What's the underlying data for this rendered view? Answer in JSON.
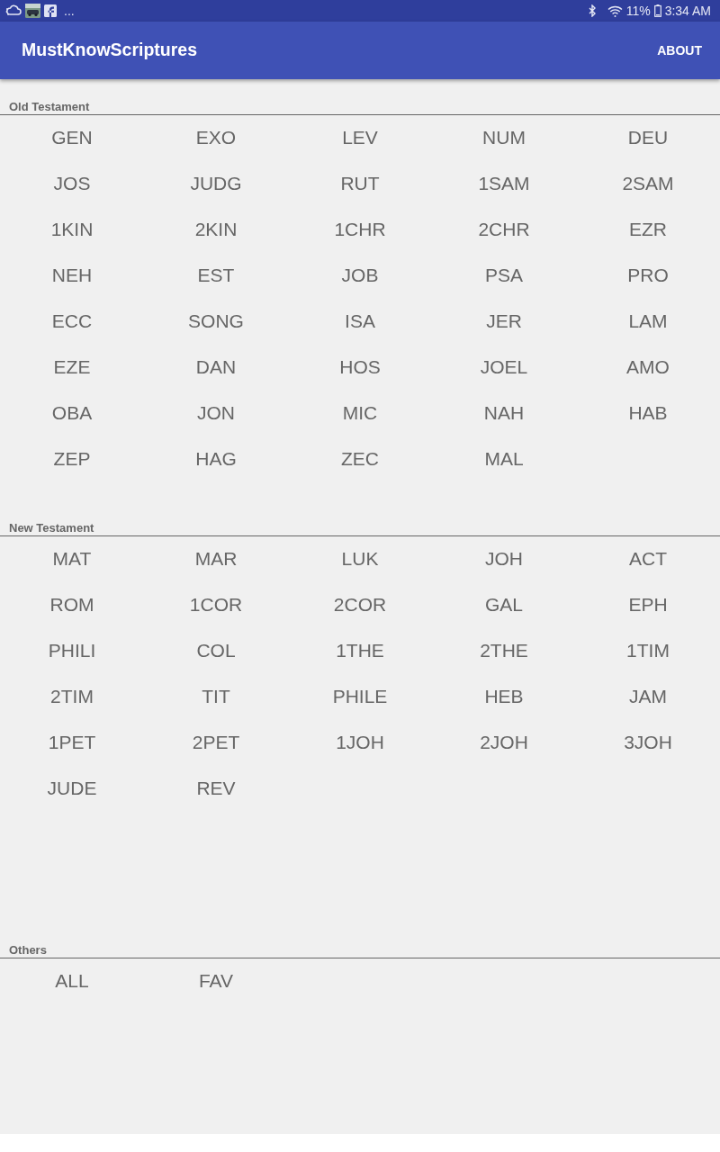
{
  "status_bar": {
    "overflow": "...",
    "battery_percent": "11%",
    "time": "3:34 AM"
  },
  "app_bar": {
    "title": "MustKnowScriptures",
    "action": "ABOUT"
  },
  "sections": [
    {
      "title": "Old Testament",
      "items": [
        "GEN",
        "EXO",
        "LEV",
        "NUM",
        "DEU",
        "JOS",
        "JUDG",
        "RUT",
        "1SAM",
        "2SAM",
        "1KIN",
        "2KIN",
        "1CHR",
        "2CHR",
        "EZR",
        "NEH",
        "EST",
        "JOB",
        "PSA",
        "PRO",
        "ECC",
        "SONG",
        "ISA",
        "JER",
        "LAM",
        "EZE",
        "DAN",
        "HOS",
        "JOEL",
        "AMO",
        "OBA",
        "JON",
        "MIC",
        "NAH",
        "HAB",
        "ZEP",
        "HAG",
        "ZEC",
        "MAL"
      ]
    },
    {
      "title": "New Testament",
      "items": [
        "MAT",
        "MAR",
        "LUK",
        "JOH",
        "ACT",
        "ROM",
        "1COR",
        "2COR",
        "GAL",
        "EPH",
        "PHILI",
        "COL",
        "1THE",
        "2THE",
        "1TIM",
        "2TIM",
        "TIT",
        "PHILE",
        "HEB",
        "JAM",
        "1PET",
        "2PET",
        "1JOH",
        "2JOH",
        "3JOH",
        "JUDE",
        "REV"
      ]
    },
    {
      "title": "Others",
      "items": [
        "ALL",
        "FAV"
      ]
    }
  ]
}
